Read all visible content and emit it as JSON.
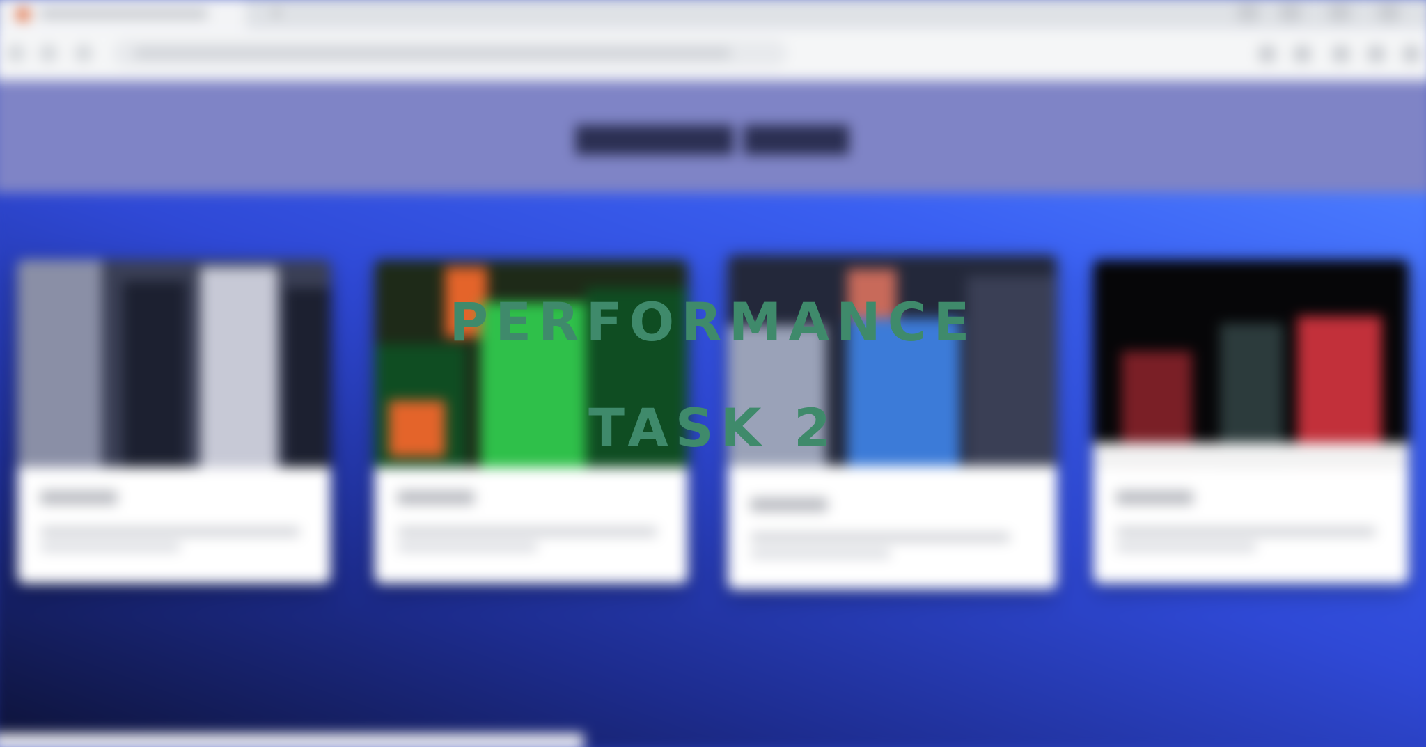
{
  "overlay": {
    "line1": "PERFORMANCE",
    "line2": "TASK 2"
  },
  "icons": {
    "favicon": "site-favicon-icon",
    "new_tab": "plus-icon",
    "back": "back-arrow-icon",
    "forward": "forward-arrow-icon",
    "reload": "reload-icon"
  },
  "colors": {
    "header_bg": "#7f84c6",
    "body_gradient_start": "#0d1236",
    "body_gradient_end": "#4a7bff",
    "overlay_text": "#3f8a6b",
    "card_bg": "#ffffff"
  },
  "cards": [
    {
      "image_colors": [
        "#3a3f55",
        "#8a8fa6",
        "#1c2030",
        "#c7c9d6"
      ]
    },
    {
      "image_colors": [
        "#1e2a18",
        "#2fc04a",
        "#e4642a",
        "#0f4d22"
      ]
    },
    {
      "image_colors": [
        "#23283a",
        "#3c7bd8",
        "#9aa2b8",
        "#c86a5a"
      ]
    },
    {
      "image_colors": [
        "#060608",
        "#7a1f26",
        "#2c3b3c",
        "#c2303a"
      ]
    }
  ]
}
